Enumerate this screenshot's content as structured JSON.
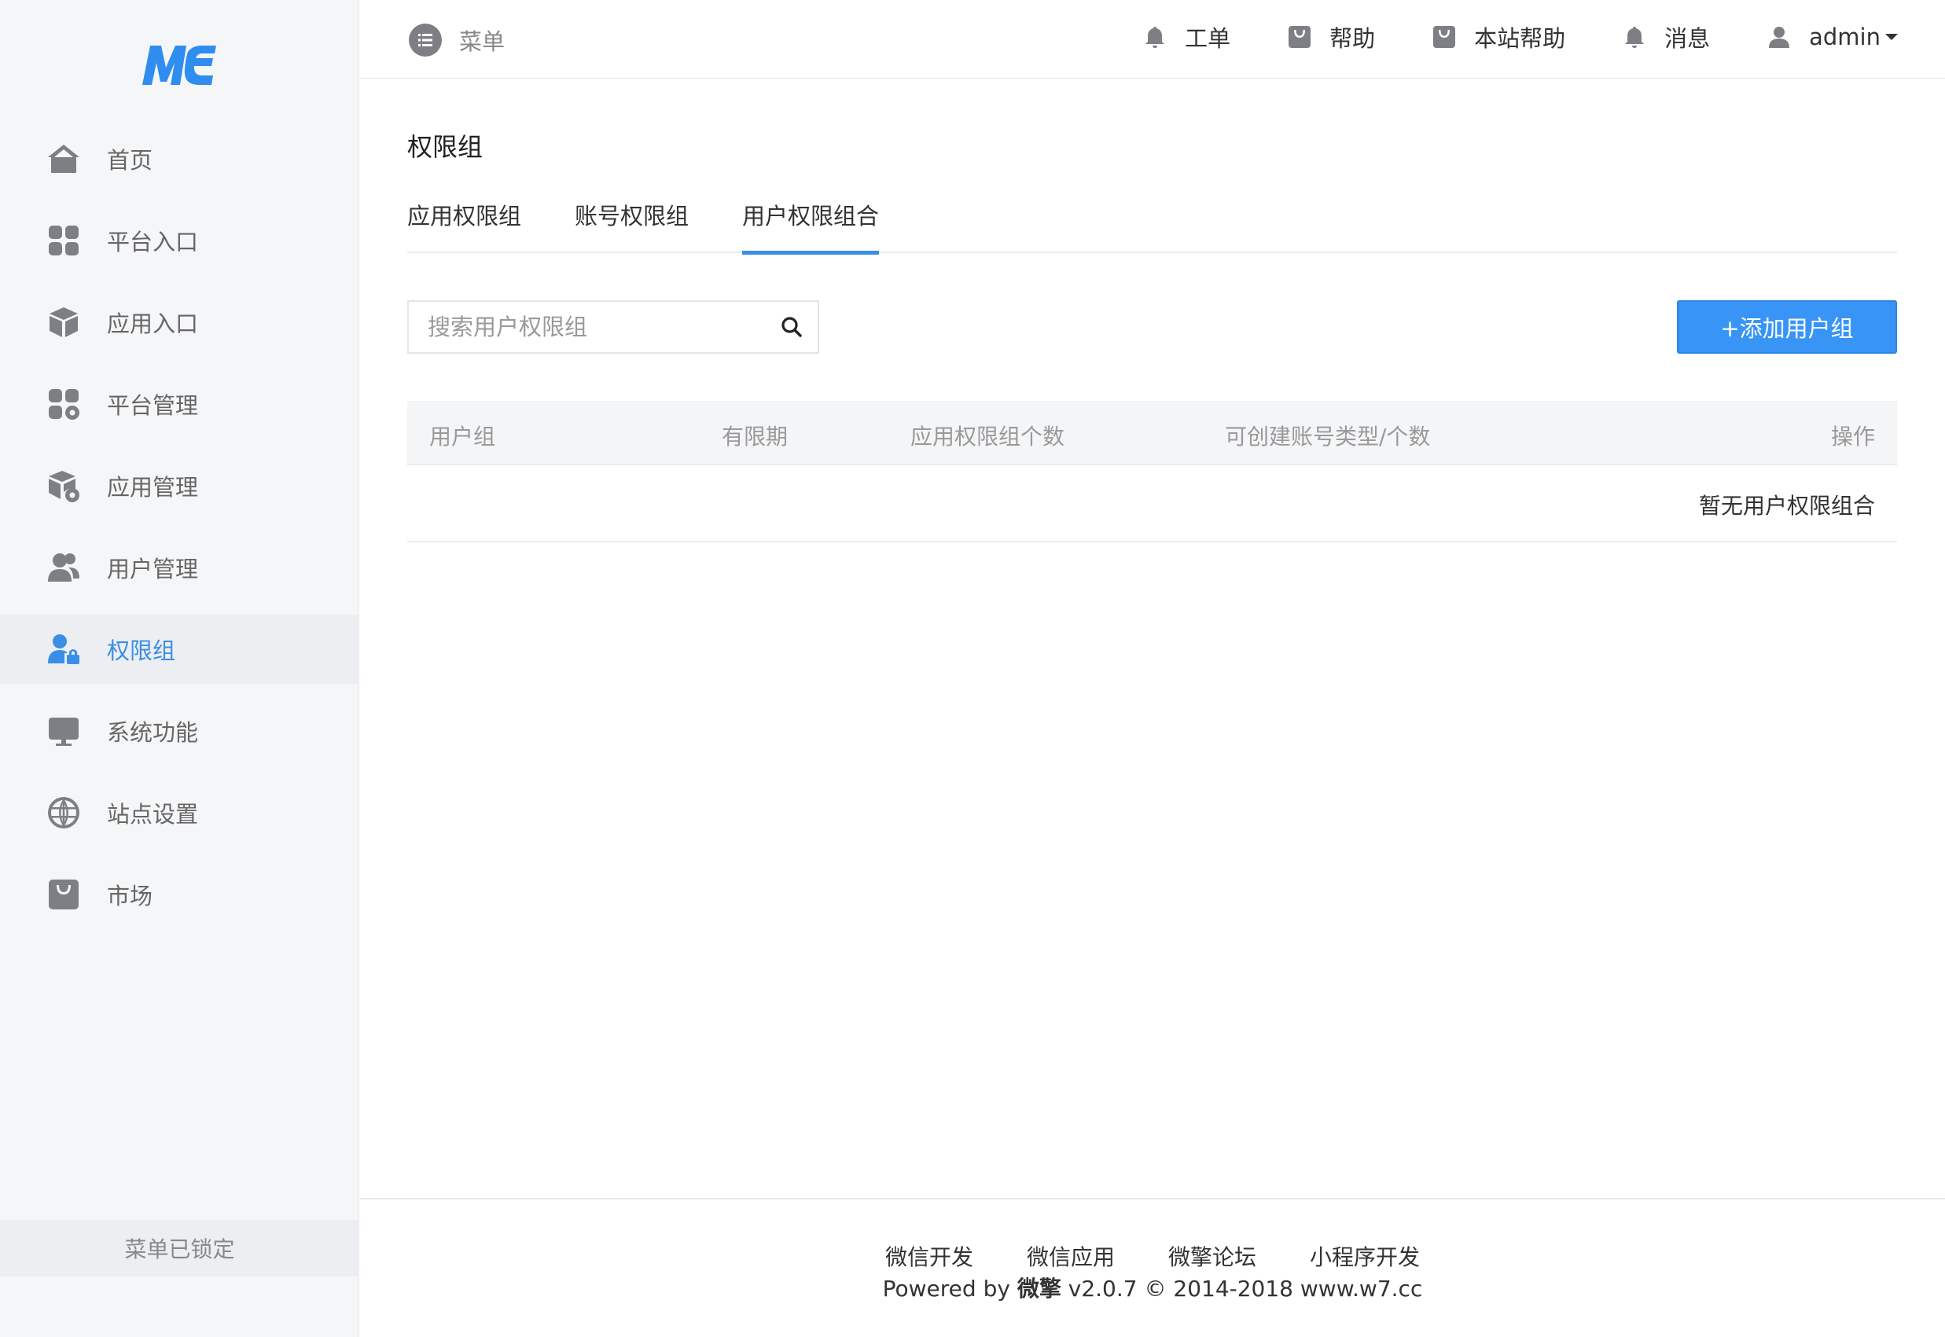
{
  "header": {
    "menu_label": "菜单",
    "links": [
      {
        "label": "工单",
        "icon": "bell-icon"
      },
      {
        "label": "帮助",
        "icon": "shopping-bag-icon"
      },
      {
        "label": "本站帮助",
        "icon": "shopping-bag-icon"
      },
      {
        "label": "消息",
        "icon": "bell-icon"
      }
    ],
    "user": "admin"
  },
  "sidebar": {
    "logo": "ME",
    "items": [
      {
        "label": "首页",
        "icon": "home-icon"
      },
      {
        "label": "平台入口",
        "icon": "grid-icon"
      },
      {
        "label": "应用入口",
        "icon": "cube-icon"
      },
      {
        "label": "平台管理",
        "icon": "grid-gear-icon"
      },
      {
        "label": "应用管理",
        "icon": "cube-gear-icon"
      },
      {
        "label": "用户管理",
        "icon": "users-icon"
      },
      {
        "label": "权限组",
        "icon": "user-lock-icon",
        "active": true
      },
      {
        "label": "系统功能",
        "icon": "monitor-icon"
      },
      {
        "label": "站点设置",
        "icon": "globe-icon"
      },
      {
        "label": "市场",
        "icon": "shopping-bag-icon"
      }
    ],
    "lock_label": "菜单已锁定"
  },
  "main": {
    "title": "权限组",
    "tabs": [
      "应用权限组",
      "账号权限组",
      "用户权限组合"
    ],
    "active_tab": 2,
    "search_placeholder": "搜索用户权限组",
    "add_button": "+添加用户组",
    "table": {
      "columns": [
        "用户组",
        "有限期",
        "应用权限组个数",
        "可创建账号类型/个数",
        "操作"
      ],
      "empty_text": "暂无用户权限组合"
    }
  },
  "footer": {
    "links": [
      "微信开发",
      "微信应用",
      "微擎论坛",
      "小程序开发"
    ],
    "powered_prefix": "Powered by",
    "brand": "微擎",
    "powered_suffix": "v2.0.7 © 2014-2018 www.w7.cc"
  },
  "colors": {
    "accent": "#3a8ee6",
    "button": "#3895f5",
    "sidebar_bg": "#f5f6f8"
  }
}
